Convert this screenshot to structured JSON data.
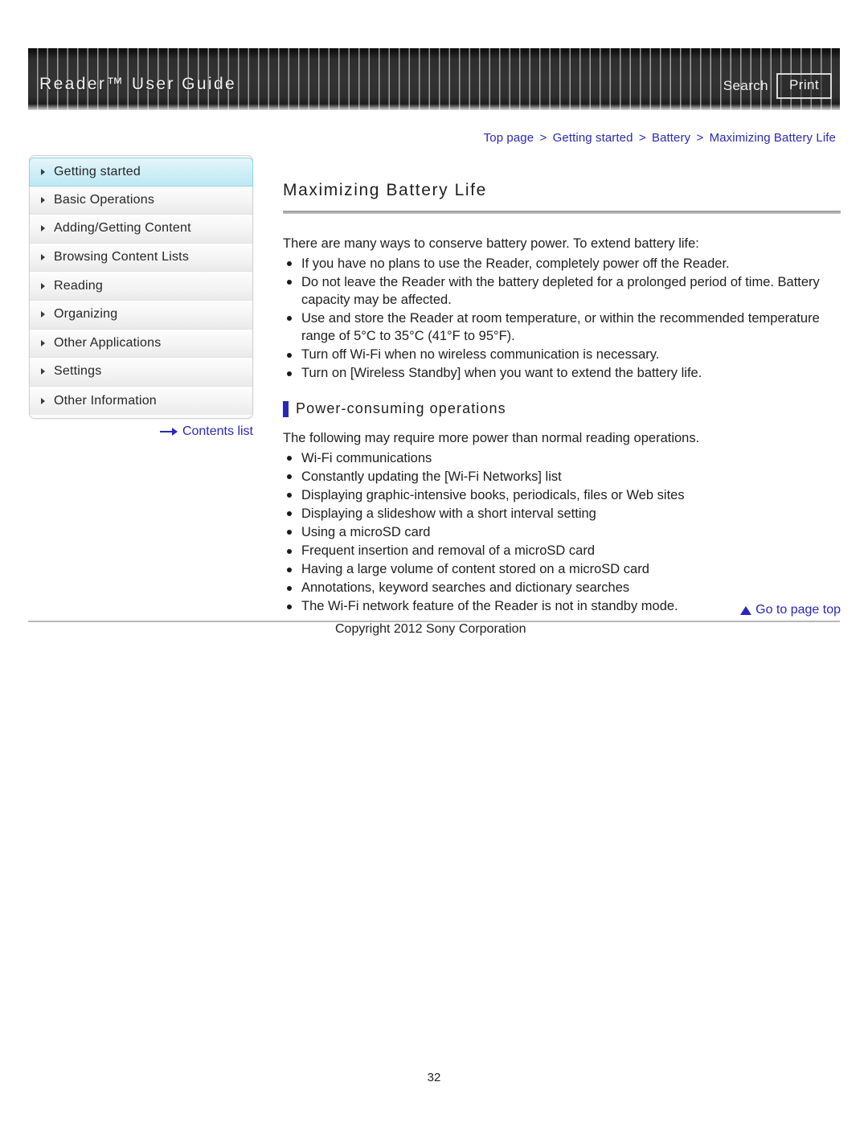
{
  "header": {
    "title": "Reader™ User Guide",
    "search_label": "Search",
    "print_label": "Print"
  },
  "breadcrumb": {
    "items": [
      {
        "label": "Top page"
      },
      {
        "label": "Getting started"
      },
      {
        "label": "Battery"
      },
      {
        "label": "Maximizing Battery Life"
      }
    ],
    "separator": ">"
  },
  "sidebar": {
    "items": [
      {
        "label": "Getting started",
        "active": true
      },
      {
        "label": "Basic Operations",
        "active": false
      },
      {
        "label": "Adding/Getting Content",
        "active": false
      },
      {
        "label": "Browsing Content Lists",
        "active": false
      },
      {
        "label": "Reading",
        "active": false
      },
      {
        "label": "Organizing",
        "active": false
      },
      {
        "label": "Other Applications",
        "active": false
      },
      {
        "label": "Settings",
        "active": false
      },
      {
        "label": "Other Information",
        "active": false
      }
    ],
    "contents_list_label": "Contents list",
    "contents_list_icon": "arrow-right-icon"
  },
  "main": {
    "title": "Maximizing Battery Life",
    "intro": "There are many ways to conserve battery power. To extend battery life:",
    "tips": [
      "If you have no plans to use the Reader, completely power off the Reader.",
      "Do not leave the Reader with the battery depleted for a prolonged period of time. Battery capacity may be affected.",
      "Use and store the Reader at room temperature, or within the recommended temperature range of 5°C to 35°C (41°F to 95°F).",
      "Turn off Wi-Fi when no wireless communication is necessary.",
      "Turn on [Wireless Standby] when you want to extend the battery life."
    ],
    "section": {
      "heading": "Power-consuming operations",
      "paragraph": "The following may require more power than normal reading operations.",
      "items": [
        "Wi-Fi communications",
        "Constantly updating the [Wi-Fi Networks] list",
        "Displaying graphic-intensive books, periodicals, files or Web sites",
        "Displaying a slideshow with a short interval setting",
        "Using a microSD card",
        "Frequent insertion and removal of a microSD card",
        "Having a large volume of content stored on a microSD card",
        "Annotations, keyword searches and dictionary searches",
        "The Wi-Fi network feature of the Reader is not in standby mode."
      ]
    }
  },
  "footer": {
    "go_top_label": "Go to page top",
    "go_top_icon": "triangle-up-icon",
    "copyright": "Copyright 2012 Sony Corporation",
    "page_number": "32"
  },
  "colors": {
    "link": "#2a28b8",
    "accent_bar": "#2a28b8",
    "active_nav": "#cfeef6",
    "banner": "#333333"
  }
}
